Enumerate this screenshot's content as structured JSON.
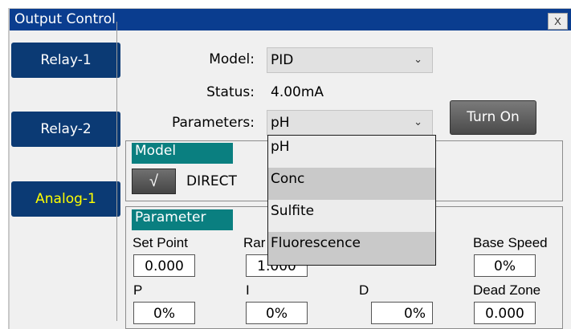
{
  "window": {
    "title": "Output Control",
    "close_label": "X"
  },
  "tabs": [
    {
      "label": "Relay-1",
      "active": false
    },
    {
      "label": "Relay-2",
      "active": false
    },
    {
      "label": "Analog-1",
      "active": true
    }
  ],
  "form": {
    "model_label": "Model:",
    "model_value": "PID",
    "status_label": "Status:",
    "status_value": "4.00mA",
    "parameters_label": "Parameters:",
    "parameters_value": "pH",
    "turn_on_label": "Turn On"
  },
  "model_group": {
    "title": "Model",
    "check_symbol": "√",
    "mode_label": "DIRECT"
  },
  "parameter_group": {
    "title": "Parameter",
    "set_point_label": "Set Point",
    "set_point_value": "0.000",
    "range_label_partial": "Rar",
    "range_value": "1.000",
    "base_speed_label": "Base Speed",
    "base_speed_value": "0%",
    "p_label": "P",
    "p_value": "0%",
    "i_label": "I",
    "i_value": "0%",
    "d_label": "D",
    "d_value": "0%",
    "dead_zone_label": "Dead Zone",
    "dead_zone_value": "0.000"
  },
  "parameters_dropdown": {
    "options": [
      "pH",
      "Conc",
      "Sulfite",
      "Fluorescence"
    ],
    "selected": "pH"
  },
  "colors": {
    "title_bar": "#0a3d8f",
    "tab_bg": "#0b3a74",
    "active_tab_text": "#ffff00",
    "group_header": "#0a7f80"
  },
  "icons": {
    "dropdown": "chevron-down-icon",
    "check": "check-icon"
  }
}
